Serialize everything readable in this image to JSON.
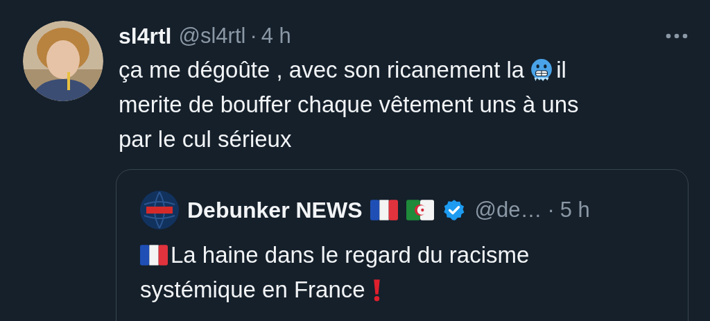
{
  "tweet": {
    "author": {
      "name": "sl4rtl",
      "handle": "@sl4rtl",
      "separator": "·",
      "time": "4 h"
    },
    "lines": [
      [
        {
          "kind": "text",
          "text": "ça me dégoûte , avec son ricanement la"
        },
        {
          "kind": "cold-face"
        },
        {
          "kind": "text",
          "text": "il"
        }
      ],
      [
        {
          "kind": "text",
          "text": "merite de bouffer chaque vêtement uns à uns"
        }
      ],
      [
        {
          "kind": "text",
          "text": "par le cul sérieux"
        }
      ]
    ],
    "quote": {
      "author": {
        "name": "Debunker NEWS",
        "flags": [
          {
            "kind": "flag-france"
          },
          {
            "kind": "flag-algeria"
          }
        ],
        "verified": true,
        "handle": "@de…",
        "separator": "·",
        "time": "5 h"
      },
      "lines": [
        [
          {
            "kind": "flag-france"
          },
          {
            "kind": "text",
            "text": "La haine dans le regard du racisme"
          }
        ],
        [
          {
            "kind": "text",
            "text": "systémique en France"
          },
          {
            "kind": "exclamation"
          }
        ]
      ]
    }
  }
}
